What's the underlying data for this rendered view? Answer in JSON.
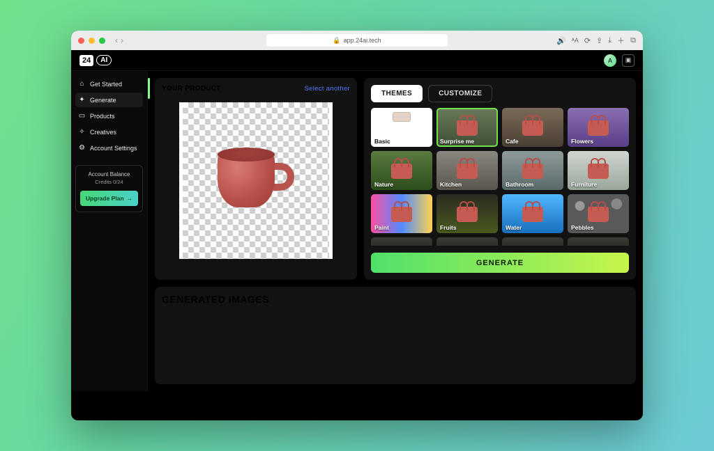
{
  "browser": {
    "url": "app.24ai.tech",
    "right_icons": [
      "volume-icon",
      "reader-icon",
      "refresh-icon",
      "share-icon",
      "download-icon",
      "plus-icon",
      "tabs-icon"
    ]
  },
  "header": {
    "logo_primary": "24",
    "logo_secondary": "AI",
    "avatar_initial": "A"
  },
  "sidebar": {
    "items": [
      {
        "icon": "home-icon",
        "label": "Get Started"
      },
      {
        "icon": "sparkle-icon",
        "label": "Generate"
      },
      {
        "icon": "box-icon",
        "label": "Products"
      },
      {
        "icon": "wand-icon",
        "label": "Creatives"
      },
      {
        "icon": "gear-icon",
        "label": "Account Settings"
      }
    ],
    "active_index": 1,
    "balance_title": "Account Balance",
    "balance_sub": "Credits 0/24",
    "upgrade_label": "Upgrade Plan"
  },
  "product_panel": {
    "title": "YOUR PRODUCT",
    "select_another": "Select another"
  },
  "themes_panel": {
    "tabs": [
      {
        "label": "THEMES",
        "active": true
      },
      {
        "label": "CUSTOMIZE",
        "active": false
      }
    ],
    "selected_theme_index": 1,
    "themes": [
      {
        "key": "basic",
        "label": "Basic"
      },
      {
        "key": "surprise",
        "label": "Surprise me"
      },
      {
        "key": "cafe",
        "label": "Cafe"
      },
      {
        "key": "flowers",
        "label": "Flowers"
      },
      {
        "key": "nature",
        "label": "Nature"
      },
      {
        "key": "kitchen",
        "label": "Kitchen"
      },
      {
        "key": "bathroom",
        "label": "Bathroom"
      },
      {
        "key": "furniture",
        "label": "Furniture"
      },
      {
        "key": "paint",
        "label": "Paint"
      },
      {
        "key": "fruits",
        "label": "Fruits"
      },
      {
        "key": "water",
        "label": "Water"
      },
      {
        "key": "pebbles",
        "label": "Pebbles"
      }
    ],
    "generate_button": "GENERATE"
  },
  "generated_panel": {
    "title": "GENERATED IMAGES"
  }
}
